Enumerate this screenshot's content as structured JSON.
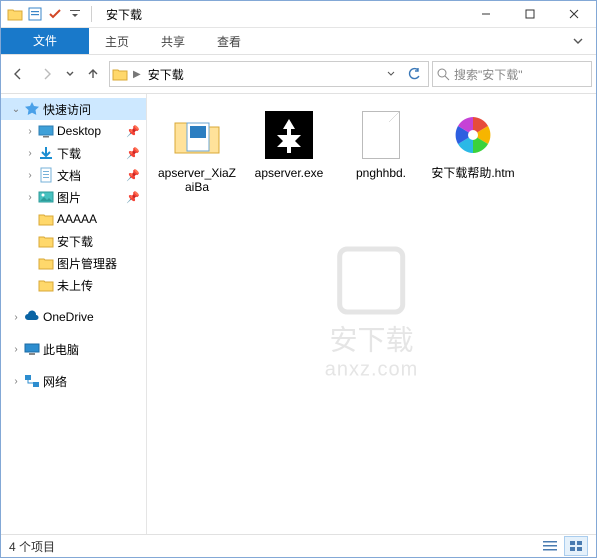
{
  "title_bar": {
    "title": "安下载"
  },
  "ribbon": {
    "file": "文件",
    "home": "主页",
    "share": "共享",
    "view": "查看"
  },
  "address": {
    "segment": "安下载",
    "search_placeholder": "搜索\"安下载\""
  },
  "sidebar": {
    "quick_access": "快速访问",
    "items": [
      {
        "label": "Desktop",
        "pinned": true
      },
      {
        "label": "下载",
        "pinned": true
      },
      {
        "label": "文档",
        "pinned": true
      },
      {
        "label": "图片",
        "pinned": true
      },
      {
        "label": "AAAAA",
        "pinned": false
      },
      {
        "label": "安下载",
        "pinned": false
      },
      {
        "label": "图片管理器",
        "pinned": false
      },
      {
        "label": "未上传",
        "pinned": false
      }
    ],
    "onedrive": "OneDrive",
    "this_pc": "此电脑",
    "network": "网络"
  },
  "files": [
    {
      "name": "apserver_XiaZaiBa",
      "kind": "folder"
    },
    {
      "name": "apserver.exe",
      "kind": "exe"
    },
    {
      "name": "pnghhbd.",
      "kind": "blank"
    },
    {
      "name": "安下载帮助.htm",
      "kind": "pinwheel"
    }
  ],
  "watermark": {
    "line1": "安下载",
    "line2": "anxz.com"
  },
  "status": {
    "count": "4 个项目"
  }
}
